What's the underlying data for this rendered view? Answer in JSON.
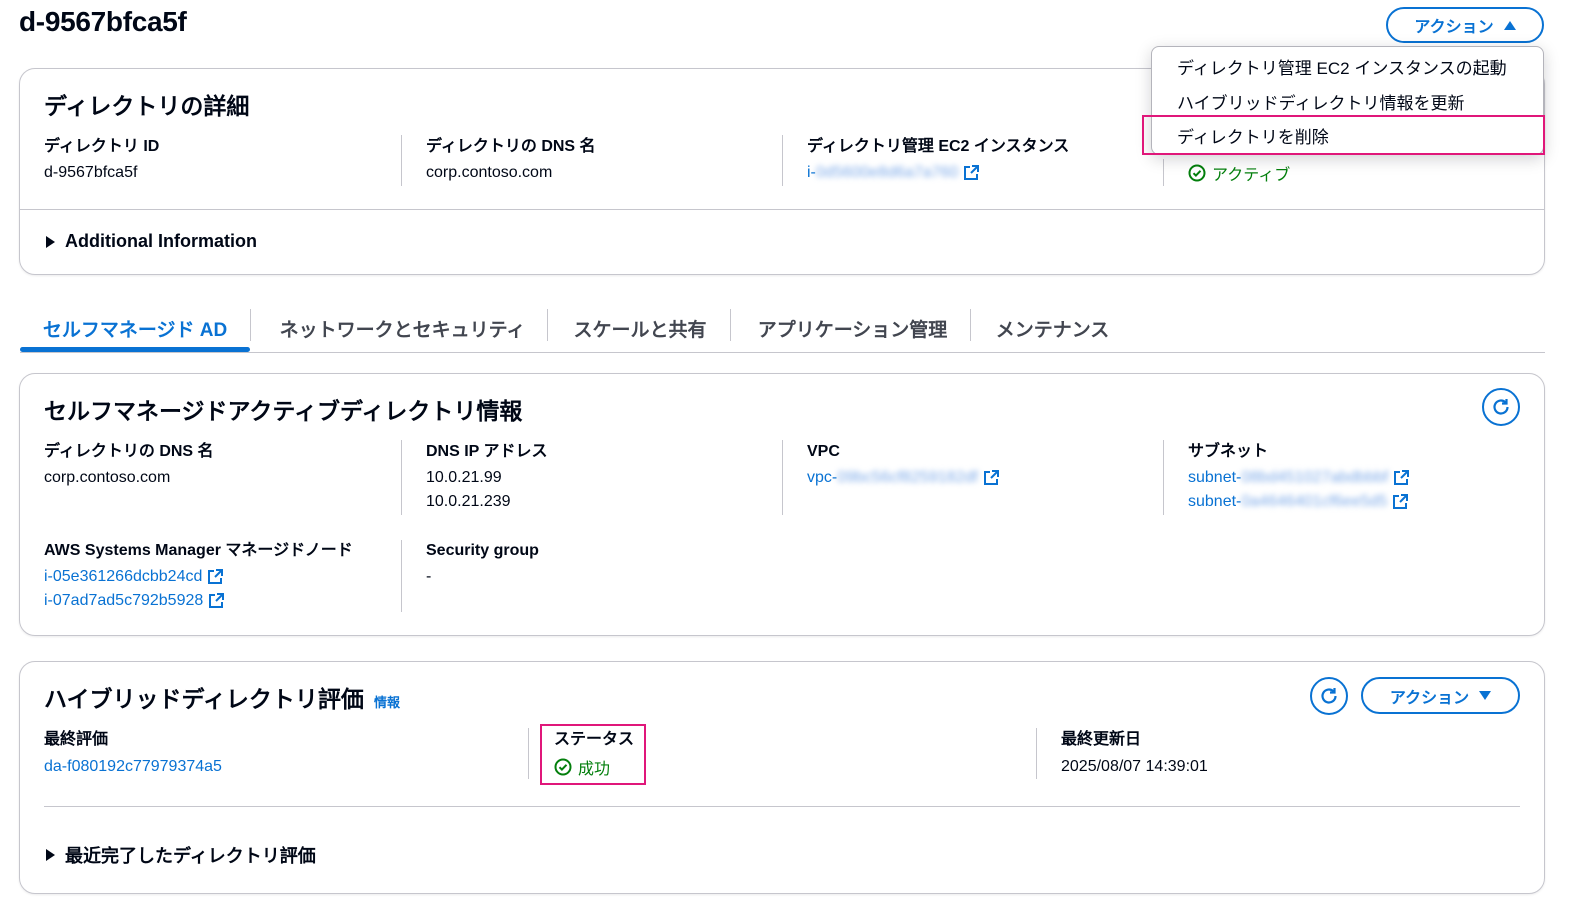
{
  "page": {
    "title": "d-9567bfca5f"
  },
  "actions_button": {
    "label": "アクション"
  },
  "actions_menu": {
    "items": [
      "ディレクトリ管理 EC2 インスタンスの起動",
      "ハイブリッドディレクトリ情報を更新",
      "ディレクトリを削除"
    ]
  },
  "details": {
    "title": "ディレクトリの詳細",
    "directory_id_label": "ディレクトリ ID",
    "directory_id": "d-9567bfca5f",
    "dns_name_label": "ディレクトリの DNS 名",
    "dns_name": "corp.contoso.com",
    "ec2_label": "ディレクトリ管理 EC2 インスタンス",
    "ec2_prefix": "i-",
    "ec2_redacted": "0d5600e8d6a7a760",
    "status": "アクティブ",
    "additional_info": "Additional Information"
  },
  "tabs": [
    "セルフマネージド AD",
    "ネットワークとセキュリティ",
    "スケールと共有",
    "アプリケーション管理",
    "メンテナンス"
  ],
  "self_managed": {
    "title": "セルフマネージドアクティブディレクトリ情報",
    "dns_name_label": "ディレクトリの DNS 名",
    "dns_name": "corp.contoso.com",
    "dns_ip_label": "DNS IP アドレス",
    "dns_ips": [
      "10.0.21.99",
      "10.0.21.239"
    ],
    "vpc_label": "VPC",
    "vpc_prefix": "vpc-",
    "vpc_redacted": "09bc56cf8259182df",
    "subnet_label": "サブネット",
    "subnet_prefix": "subnet-",
    "subnet_redacted": [
      "08bd451027abdbbbf",
      "0a4646401cf6ee5d5"
    ],
    "ssm_label": "AWS Systems Manager マネージドノード",
    "ssm_nodes": [
      "i-05e361266dcbb24cd",
      "i-07ad7ad5c792b5928"
    ],
    "sg_label": "Security group",
    "sg_value": "-"
  },
  "hybrid": {
    "title": "ハイブリッドディレクトリ評価",
    "info": "情報",
    "actions_label": "アクション",
    "last_eval_label": "最終評価",
    "last_eval": "da-f080192c77979374a5",
    "status_label": "ステータス",
    "status": "成功",
    "updated_label": "最終更新日",
    "updated": "2025/08/07 14:39:01",
    "recent": "最近完了したディレクトリ評価"
  },
  "colors": {
    "accent": "#0972d3",
    "success": "#037f0c",
    "highlight": "#e0177a"
  }
}
